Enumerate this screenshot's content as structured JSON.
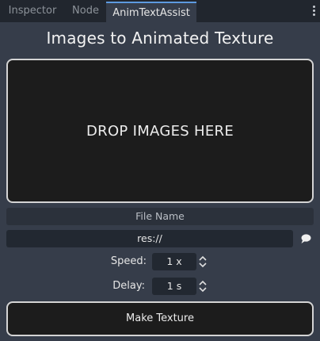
{
  "tabs": [
    {
      "label": "Inspector",
      "active": false
    },
    {
      "label": "Node",
      "active": false
    },
    {
      "label": "AnimTextAssist",
      "active": true
    }
  ],
  "menu_icon": "kebab-menu-icon",
  "title": "Images to Animated Texture",
  "dropzone": {
    "label": "DROP IMAGES HERE"
  },
  "file_name": {
    "label": "File Name"
  },
  "path": {
    "value": "res://",
    "browse_icon": "speech-bubble-icon"
  },
  "speed": {
    "label": "Speed:",
    "value": "1 x"
  },
  "delay": {
    "label": "Delay:",
    "value": "1 s"
  },
  "make_button": {
    "label": "Make Texture"
  },
  "colors": {
    "panel_bg": "#363d4a",
    "tabbar_bg": "#21262e",
    "active_tab_accent": "#5d9ae0",
    "dark_box": "#1c1c1c",
    "border_light": "#d4d4d4"
  }
}
